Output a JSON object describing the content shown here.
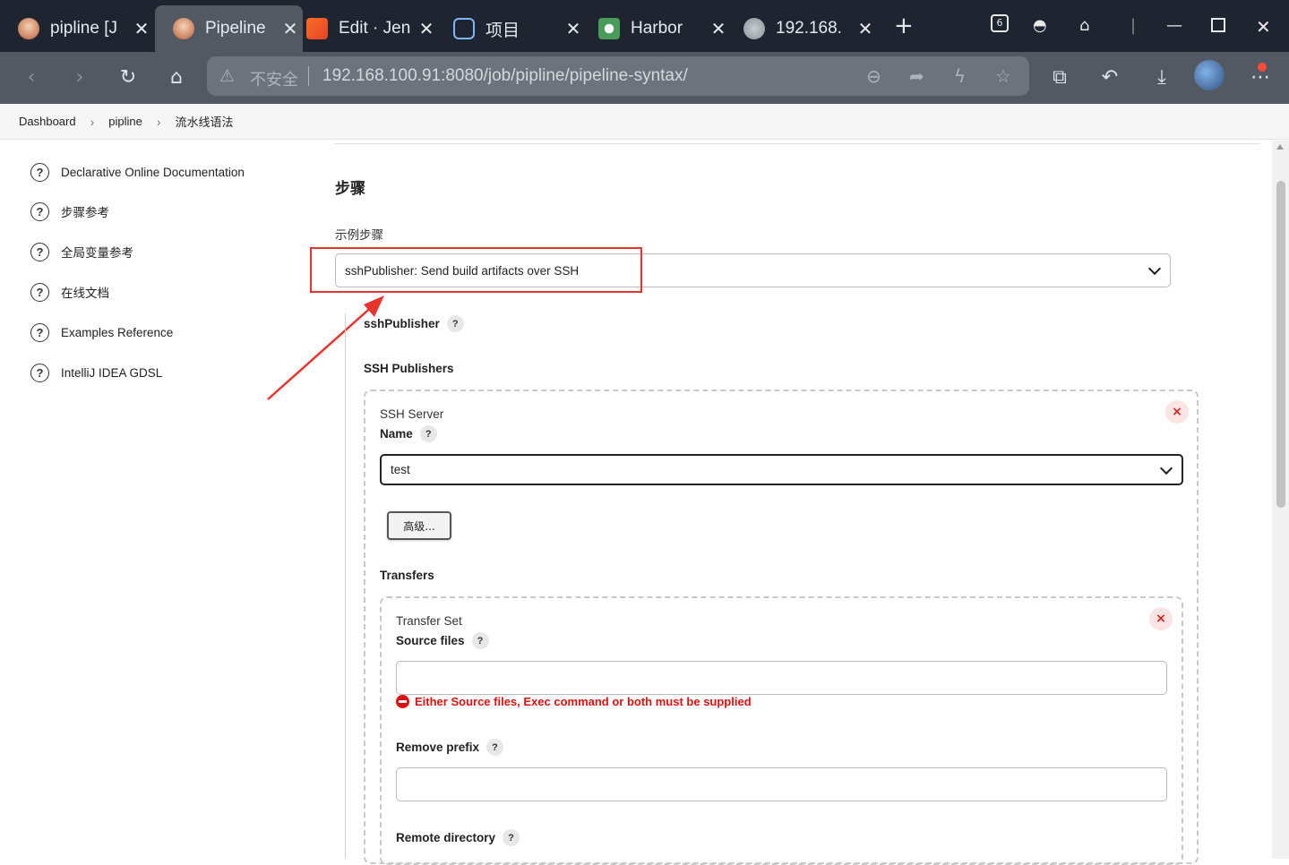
{
  "browser": {
    "tabs": [
      {
        "title": "pipline [J",
        "icon": "jenkins-icon",
        "active": false
      },
      {
        "title": "Pipeline",
        "icon": "jenkins-icon",
        "active": true
      },
      {
        "title": "Edit · Jen",
        "icon": "gitlab-icon",
        "active": false
      },
      {
        "title": "项目",
        "icon": "app-icon",
        "active": false
      },
      {
        "title": "Harbor",
        "icon": "harbor-icon",
        "active": false
      },
      {
        "title": "192.168.",
        "icon": "globe-icon",
        "active": false
      }
    ],
    "new_tab": "+",
    "insecure_label": "不安全",
    "url": "192.168.100.91:8080/job/pipline/pipeline-syntax/",
    "tab_counter": "6",
    "accent": "#1f2530"
  },
  "breadcrumb": [
    "Dashboard",
    "pipline",
    "流水线语法"
  ],
  "sidebar": {
    "items": [
      {
        "label": "Declarative Online Documentation",
        "icon": "help-icon"
      },
      {
        "label": "步骤参考",
        "icon": "help-icon"
      },
      {
        "label": "全局变量参考",
        "icon": "help-icon"
      },
      {
        "label": "在线文档",
        "icon": "help-icon"
      },
      {
        "label": "Examples Reference",
        "icon": "help-icon"
      },
      {
        "label": "IntelliJ IDEA GDSL",
        "icon": "help-icon"
      }
    ]
  },
  "main": {
    "section_title": "步骤",
    "sample_step_label": "示例步骤",
    "sample_step_value": "sshPublisher: Send build artifacts over SSH",
    "step_name": "sshPublisher",
    "ssh_publishers_label": "SSH Publishers",
    "ssh_server": {
      "heading": "SSH Server",
      "name_label": "Name",
      "name_value": "test",
      "advanced_button": "高级..."
    },
    "transfers_label": "Transfers",
    "transfer_set": {
      "heading": "Transfer Set",
      "source_files_label": "Source files",
      "source_files_value": "",
      "error": "Either Source files, Exec command or both must be supplied",
      "remove_prefix_label": "Remove prefix",
      "remove_prefix_value": "",
      "remote_directory_label": "Remote directory"
    },
    "help_glyph": "?",
    "remove_glyph": "×",
    "error_color": "#dd1111"
  }
}
